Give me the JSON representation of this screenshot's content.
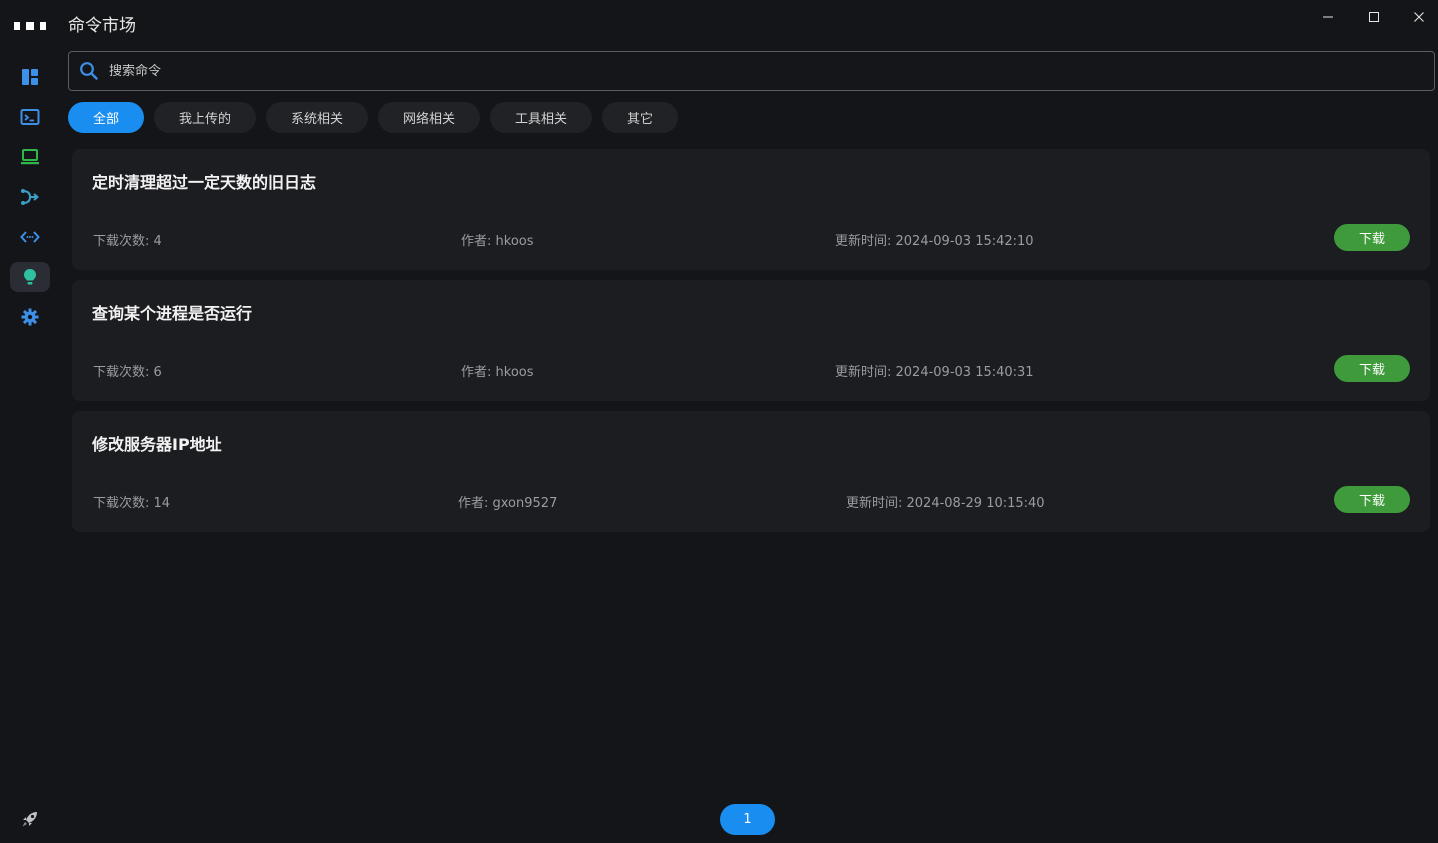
{
  "window": {
    "title": "命令市场"
  },
  "sidebar": {
    "items": [
      {
        "icon": "dashboard-icon",
        "color": "#3d8fe8"
      },
      {
        "icon": "terminal-icon",
        "color": "#3d8fe8"
      },
      {
        "icon": "laptop-icon",
        "color": "#2fb84a"
      },
      {
        "icon": "network-icon",
        "color": "#3aa0c8"
      },
      {
        "icon": "code-icon",
        "color": "#3d8fe8"
      },
      {
        "icon": "lightbulb-icon",
        "color": "#2fc0a0",
        "active": true
      },
      {
        "icon": "gear-icon",
        "color": "#3d8fe8"
      }
    ],
    "bottom_icon": "rocket-icon"
  },
  "search": {
    "placeholder": "搜索命令",
    "value": ""
  },
  "tabs": [
    {
      "label": "全部",
      "active": true
    },
    {
      "label": "我上传的",
      "active": false
    },
    {
      "label": "系统相关",
      "active": false
    },
    {
      "label": "网络相关",
      "active": false
    },
    {
      "label": "工具相关",
      "active": false
    },
    {
      "label": "其它",
      "active": false
    }
  ],
  "commands": [
    {
      "title": "定时清理超过一定天数的旧日志",
      "downloads": "下载次数: 4",
      "author": "作者: hkoos",
      "updated": "更新时间: 2024-09-03 15:42:10",
      "button": "下载"
    },
    {
      "title": "查询某个进程是否运行",
      "downloads": "下载次数: 6",
      "author": "作者: hkoos",
      "updated": "更新时间: 2024-09-03 15:40:31",
      "button": "下载"
    },
    {
      "title": "修改服务器IP地址",
      "downloads": "下载次数: 14",
      "author": "作者: gxon9527",
      "updated": "更新时间: 2024-08-29 10:15:40",
      "button": "下载"
    }
  ],
  "pagination": {
    "current": "1"
  },
  "colors": {
    "accent": "#1a8ef0",
    "download": "#3f9a3b",
    "background": "#141518",
    "card": "#1c1d21"
  }
}
